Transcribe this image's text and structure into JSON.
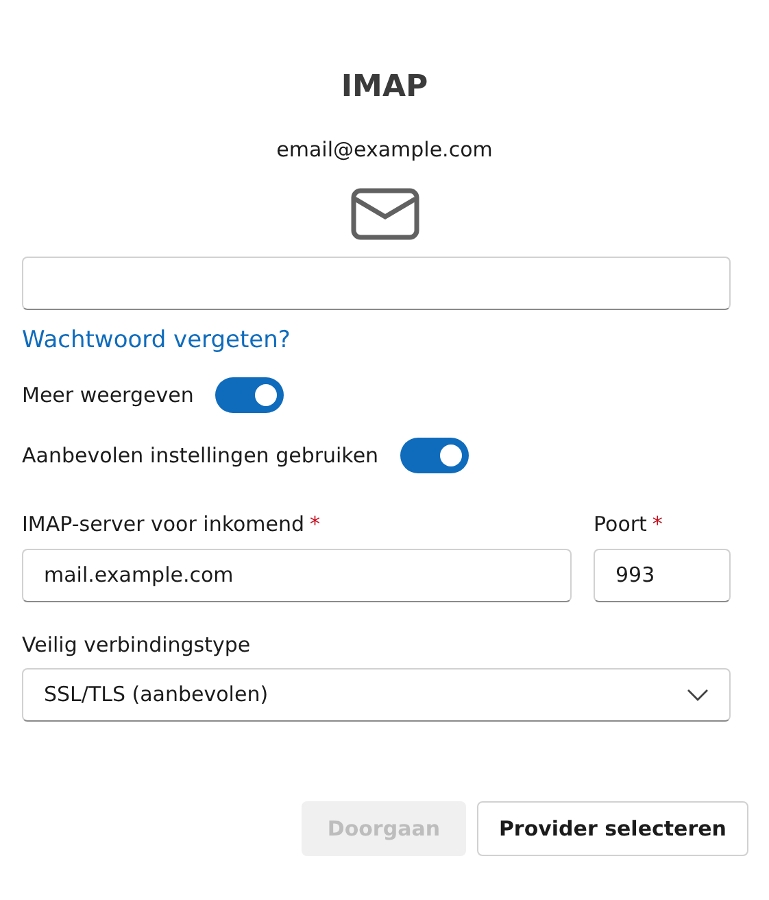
{
  "title": "IMAP",
  "account": "email@example.com",
  "forgot_link": "Wachtwoord vergeten?",
  "toggles": [
    {
      "label": "Meer weergeven",
      "on": true
    },
    {
      "label": "Aanbevolen instellingen gebruiken",
      "on": true
    }
  ],
  "server": {
    "label": "IMAP-server voor inkomend",
    "required_mark": "*",
    "value": "mail.example.com"
  },
  "port": {
    "label": "Poort",
    "required_mark": "*",
    "value": "993"
  },
  "security": {
    "label": "Veilig verbindingstype",
    "value": "SSL/TLS (aanbevolen)"
  },
  "buttons": [
    {
      "label": "Doorgaan",
      "disabled": true
    },
    {
      "label": "Provider selecteren",
      "disabled": false
    }
  ]
}
